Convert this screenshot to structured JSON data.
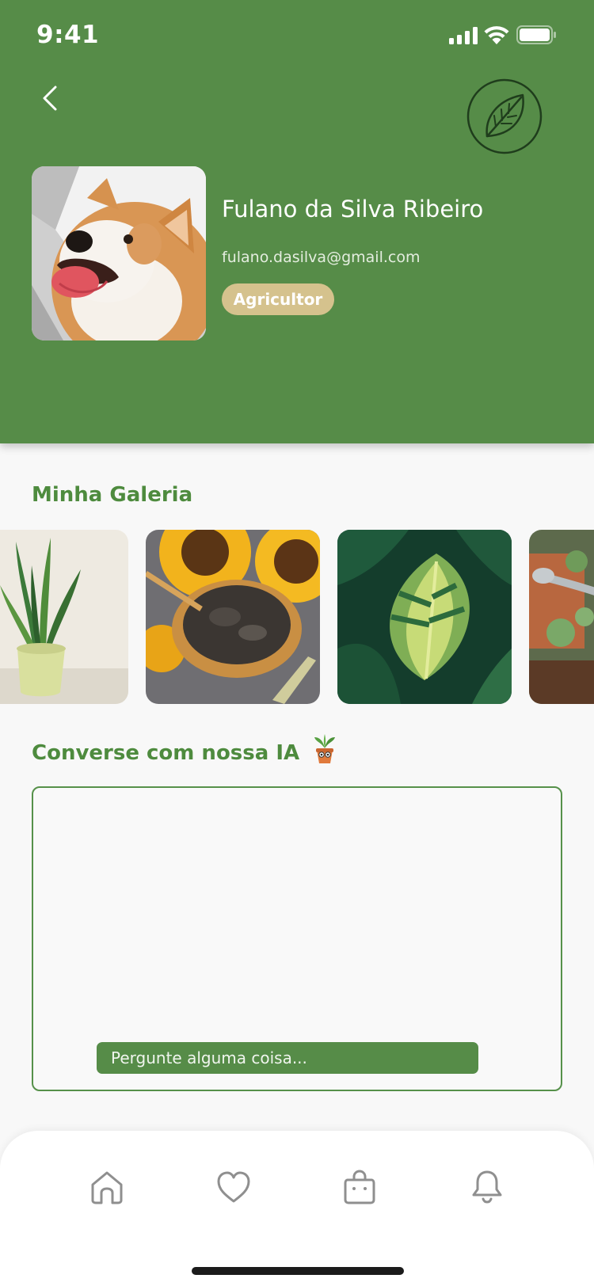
{
  "status_bar": {
    "time": "9:41"
  },
  "header": {
    "back_icon": "chevron-left-icon",
    "logo_icon": "leaf-icon",
    "colors": {
      "background": "#568c48",
      "badge": "#d5c28d"
    }
  },
  "profile": {
    "name": "Fulano da Silva Ribeiro",
    "email": "fulano.dasilva@gmail.com",
    "role": "Agricultor",
    "avatar": "corgi-dog-photo"
  },
  "gallery": {
    "title": "Minha Galeria",
    "items": [
      {
        "subject": "snake-plant-in-pot"
      },
      {
        "subject": "sunflowers-and-seeds-bowl"
      },
      {
        "subject": "variegated-monstera-leaves"
      },
      {
        "subject": "watering-can-with-plants"
      }
    ]
  },
  "chat": {
    "title": "Converse com nossa IA",
    "title_icon": "potted-plant-emoji",
    "placeholder": "Pergunte alguma coisa..."
  },
  "bottom_nav": {
    "items": [
      {
        "icon": "home-icon"
      },
      {
        "icon": "heart-icon"
      },
      {
        "icon": "shopping-bag-icon"
      },
      {
        "icon": "bell-icon"
      }
    ]
  }
}
